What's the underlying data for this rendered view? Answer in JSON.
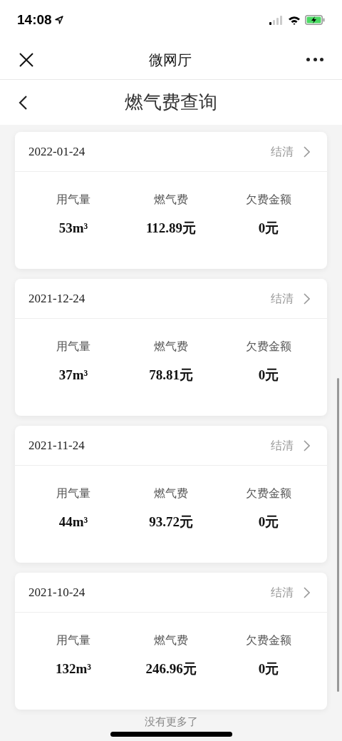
{
  "status_bar": {
    "time": "14:08"
  },
  "nav_bar": {
    "title": "微网厅"
  },
  "page_header": {
    "title": "燃气费查询"
  },
  "bills": [
    {
      "date": "2022-01-24",
      "status": "结清",
      "fields": [
        {
          "label": "用气量",
          "value": "53m³"
        },
        {
          "label": "燃气费",
          "value": "112.89元"
        },
        {
          "label": "欠费金额",
          "value": "0元"
        }
      ]
    },
    {
      "date": "2021-12-24",
      "status": "结清",
      "fields": [
        {
          "label": "用气量",
          "value": "37m³"
        },
        {
          "label": "燃气费",
          "value": "78.81元"
        },
        {
          "label": "欠费金额",
          "value": "0元"
        }
      ]
    },
    {
      "date": "2021-11-24",
      "status": "结清",
      "fields": [
        {
          "label": "用气量",
          "value": "44m³"
        },
        {
          "label": "燃气费",
          "value": "93.72元"
        },
        {
          "label": "欠费金额",
          "value": "0元"
        }
      ]
    },
    {
      "date": "2021-10-24",
      "status": "结清",
      "fields": [
        {
          "label": "用气量",
          "value": "132m³"
        },
        {
          "label": "燃气费",
          "value": "246.96元"
        },
        {
          "label": "欠费金额",
          "value": "0元"
        }
      ]
    }
  ],
  "footer": "没有更多了"
}
